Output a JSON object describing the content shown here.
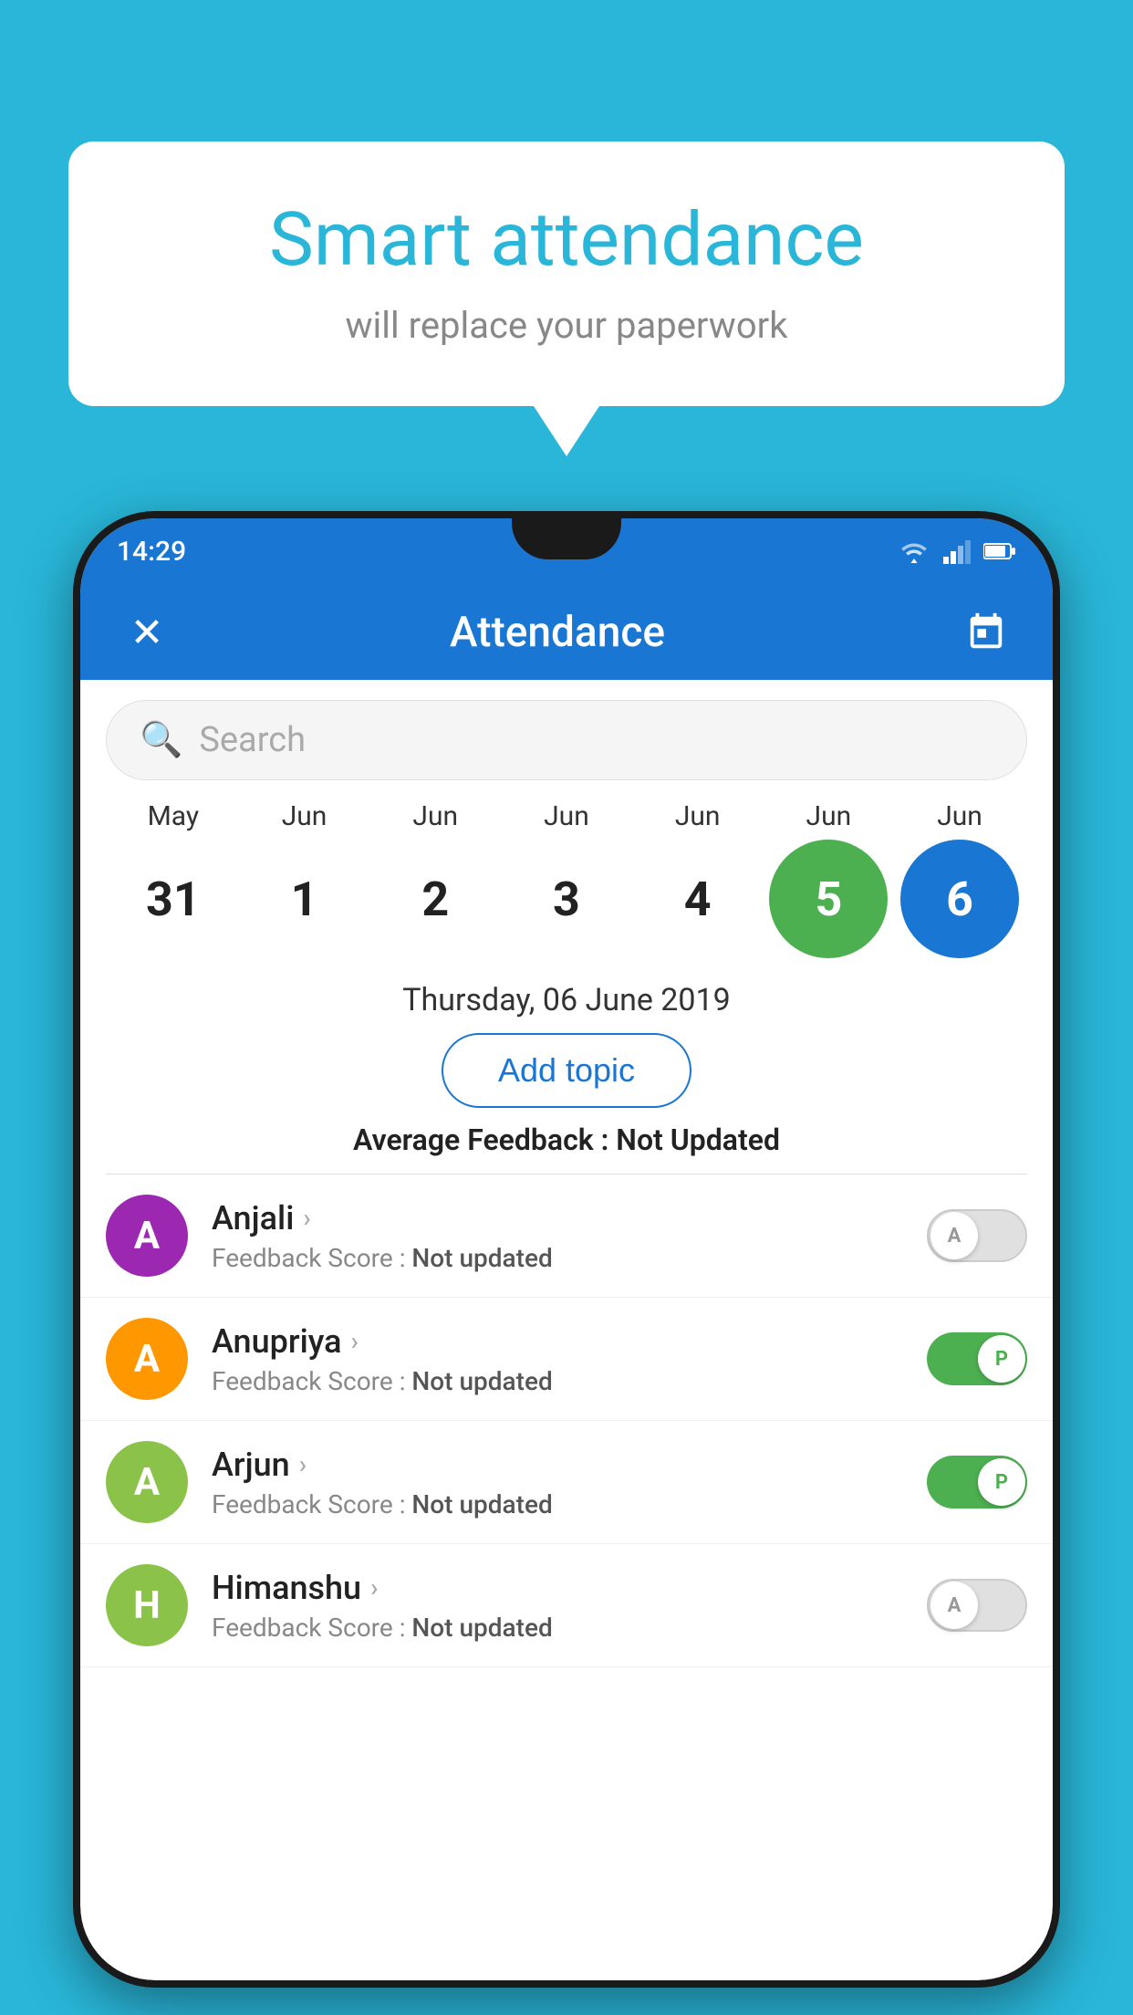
{
  "background_color": "#29b6d8",
  "speech_bubble": {
    "title": "Smart attendance",
    "subtitle": "will replace your paperwork"
  },
  "status_bar": {
    "time": "14:29",
    "wifi": true,
    "signal": true,
    "battery": true
  },
  "app_bar": {
    "title": "Attendance",
    "close_icon": "✕",
    "calendar_icon": "calendar"
  },
  "search": {
    "placeholder": "Search"
  },
  "calendar": {
    "months": [
      "May",
      "Jun",
      "Jun",
      "Jun",
      "Jun",
      "Jun",
      "Jun"
    ],
    "dates": [
      "31",
      "1",
      "2",
      "3",
      "4",
      "5",
      "6"
    ],
    "today_index": 5,
    "selected_index": 6,
    "selected_date_label": "Thursday, 06 June 2019"
  },
  "add_topic_button": "Add topic",
  "avg_feedback": {
    "label": "Average Feedback :",
    "value": "Not Updated"
  },
  "students": [
    {
      "name": "Anjali",
      "avatar_letter": "A",
      "avatar_color": "#9c27b0",
      "feedback_label": "Feedback Score :",
      "feedback_value": "Not updated",
      "attendance": "A",
      "toggle_state": "off"
    },
    {
      "name": "Anupriya",
      "avatar_letter": "A",
      "avatar_color": "#ff9800",
      "feedback_label": "Feedback Score :",
      "feedback_value": "Not updated",
      "attendance": "P",
      "toggle_state": "on"
    },
    {
      "name": "Arjun",
      "avatar_letter": "A",
      "avatar_color": "#8bc34a",
      "feedback_label": "Feedback Score :",
      "feedback_value": "Not updated",
      "attendance": "P",
      "toggle_state": "on"
    },
    {
      "name": "Himanshu",
      "avatar_letter": "H",
      "avatar_color": "#8bc34a",
      "feedback_label": "Feedback Score :",
      "feedback_value": "Not updated",
      "attendance": "A",
      "toggle_state": "off"
    }
  ]
}
